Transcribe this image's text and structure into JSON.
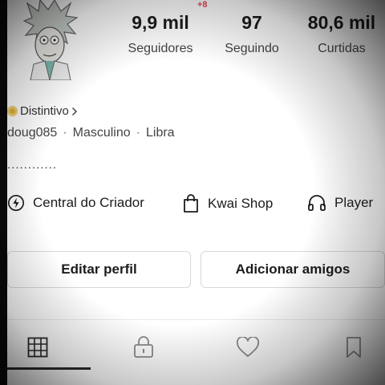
{
  "header": {
    "notification_badge": "+8",
    "stats": [
      {
        "value": "9,9 mil",
        "label": "Seguidores"
      },
      {
        "value": "97",
        "label": "Seguindo"
      },
      {
        "value": "80,6 mil",
        "label": "Curtidas"
      }
    ]
  },
  "profile": {
    "distintivo": "Distintivo",
    "username": "doug085",
    "gender": "Masculino",
    "sign": "Libra",
    "bio": "............"
  },
  "tools": [
    {
      "label": "Central do Criador",
      "icon": "lightning-icon"
    },
    {
      "label": "Kwai Shop",
      "icon": "shopping-bag-icon"
    },
    {
      "label": "Player",
      "icon": "headphones-icon"
    }
  ],
  "buttons": {
    "edit_profile": "Editar perfil",
    "add_friends": "Adicionar amigos"
  },
  "tabs": [
    {
      "icon": "grid-icon",
      "active": true
    },
    {
      "icon": "lock-icon",
      "active": false
    },
    {
      "icon": "heart-icon",
      "active": false
    },
    {
      "icon": "bookmark-icon",
      "active": false
    }
  ]
}
